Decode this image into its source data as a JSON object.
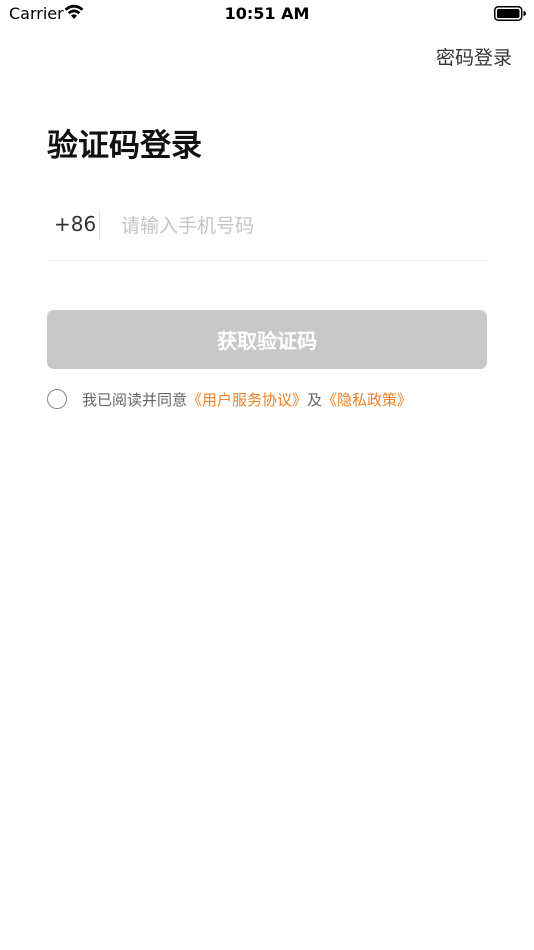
{
  "status_bar": {
    "carrier": "Carrier",
    "time": "10:51 AM"
  },
  "header": {
    "password_login_link": "密码登录"
  },
  "main": {
    "title": "验证码登录",
    "country_code": "+86",
    "phone_placeholder": "请输入手机号码",
    "phone_value": "",
    "get_code_button": "获取验证码",
    "agreement": {
      "prefix": "我已阅读并同意",
      "user_agreement": "《用户服务协议》",
      "conjunction": "及",
      "privacy_policy": "《隐私政策》",
      "checked": false
    }
  },
  "colors": {
    "accent_link": "#e8822a",
    "button_disabled": "#c8c8c8"
  },
  "icons": [
    "wifi-icon",
    "battery-icon",
    "checkbox-circle-icon"
  ]
}
